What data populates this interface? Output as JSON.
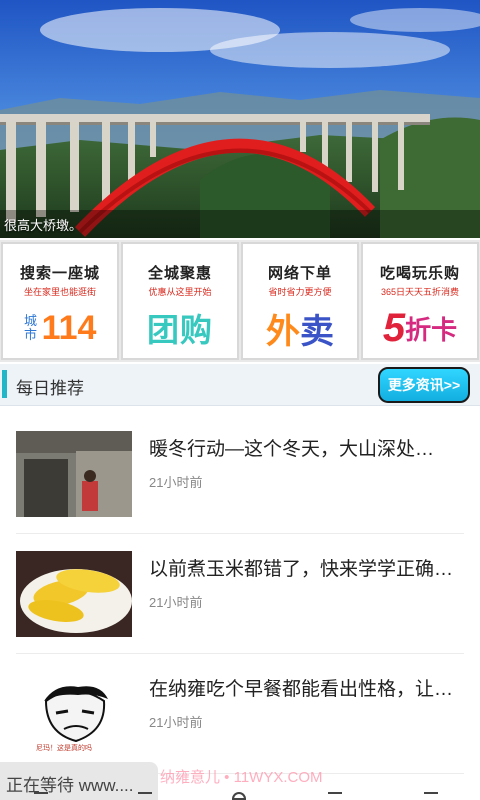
{
  "banner": {
    "caption": "很高大桥墩。"
  },
  "services": [
    {
      "title": "搜索一座城",
      "sub": "坐在家里也能逛街",
      "big_small": "城市",
      "big_main": "114"
    },
    {
      "title": "全城聚惠",
      "sub": "优惠从这里开始",
      "big_main": "团购"
    },
    {
      "title": "网络下单",
      "sub": "省时省力更方便",
      "big_a": "外",
      "big_b": "卖"
    },
    {
      "title": "吃喝玩乐购",
      "sub": "365日天天五折消费",
      "big_num": "5",
      "big_text": "折卡"
    }
  ],
  "section": {
    "title": "每日推荐",
    "more": "更多资讯>>"
  },
  "news": [
    {
      "headline": "暖冬行动—这个冬天，大山深处…",
      "time": "21小时前",
      "thumb": "village-photo"
    },
    {
      "headline": "以前煮玉米都错了，快来学学正确…",
      "time": "21小时前",
      "thumb": "corn-photo"
    },
    {
      "headline": "在纳雍吃个早餐都能看出性格，让…",
      "time": "21小时前",
      "thumb": "meme-drawing",
      "thumb_caption": "尼玛！这是真的吗"
    }
  ],
  "status": {
    "loading": "正在等待 www...."
  },
  "watermark": "纳雍意儿 • 11WYX.COM"
}
